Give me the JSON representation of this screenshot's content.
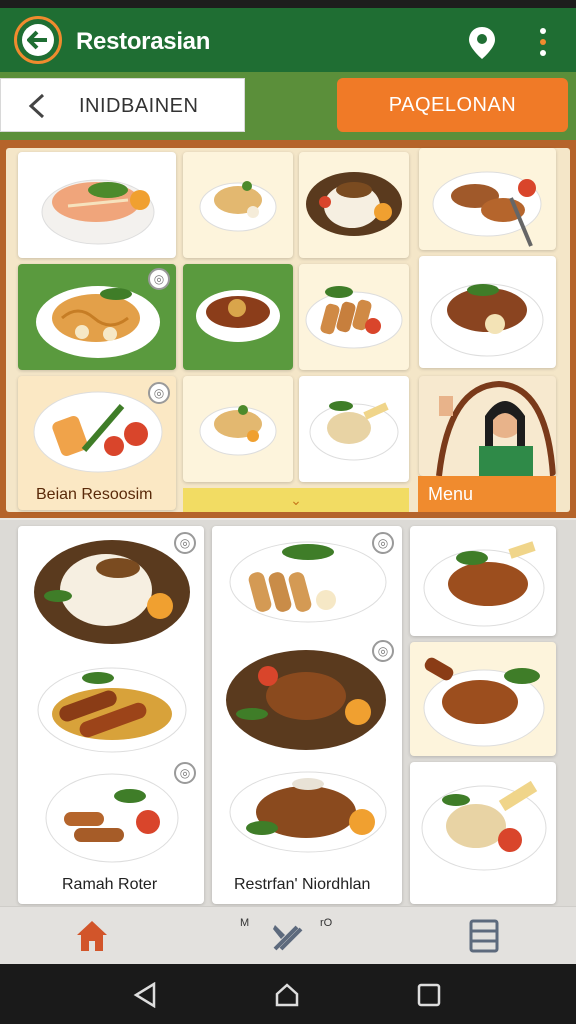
{
  "app": {
    "title": "Restorasian"
  },
  "toolbar": {
    "search_text": "INIDBAINEN",
    "orange_button": "PAQELONAN"
  },
  "section1": {
    "labels": {
      "bottom_left": "Beian Resoosim",
      "menu": "Menu",
      "expand": "⌄"
    }
  },
  "section2": {
    "labels": {
      "left": "Ramah Roter",
      "middle": "Restrfan' Niordhlan"
    }
  },
  "bottom_nav": {
    "tab_middle_small_left": "M",
    "tab_middle_small_right": "rO"
  },
  "colors": {
    "primary": "#1f6e33",
    "accent": "#f07a27",
    "brown": "#b5642a",
    "cream": "#f4e6c8"
  },
  "icons": [
    "back-arrow-icon",
    "location-pin-icon",
    "more-vert-icon",
    "chevron-left-icon",
    "home-icon",
    "food-icon",
    "list-icon",
    "android-back-icon",
    "android-home-icon",
    "android-recents-icon"
  ]
}
